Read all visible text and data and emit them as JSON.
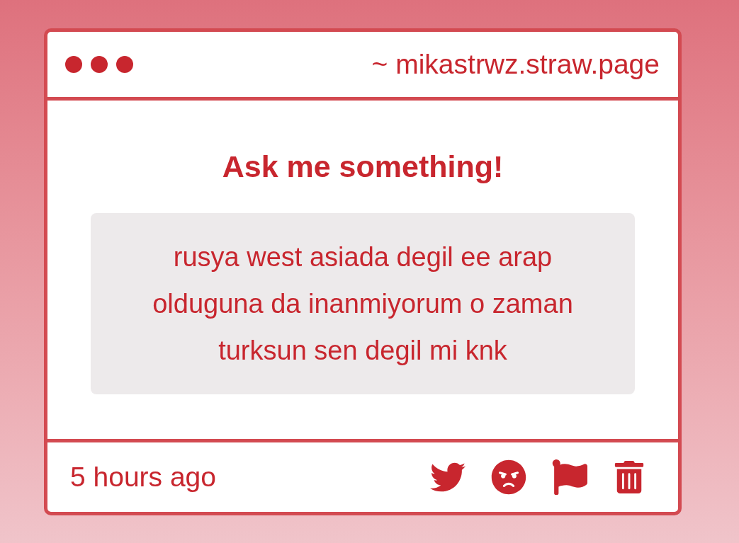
{
  "window": {
    "url": "~ mikastrwz.straw.page"
  },
  "heading": "Ask me something!",
  "question": "rusya west asiada degil ee arap olduguna da inanmiyorum o zaman turksun sen degil mi knk",
  "footer": {
    "time": "5 hours ago"
  }
}
